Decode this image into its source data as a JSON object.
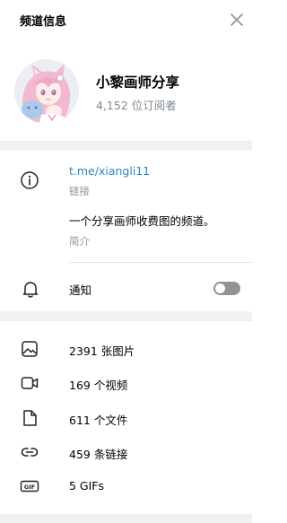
{
  "header": {
    "title": "频道信息"
  },
  "profile": {
    "name": "小黎画师分享",
    "subscribers": "4,152 位订阅者"
  },
  "info": {
    "link": "t.me/xiangli11",
    "link_caption": "链接",
    "description": "一个分享画师收费图的频道。",
    "description_caption": "简介",
    "notifications_label": "通知",
    "notifications_on": false
  },
  "media": {
    "photos": "2391 张图片",
    "videos": "169 个视频",
    "files": "611 个文件",
    "links": "459 条链接",
    "gifs": "5 GIFs",
    "gif_badge": "GIF"
  },
  "colors": {
    "link": "#2e86c1",
    "muted": "#7f8a94",
    "divider": "#f1f1f1",
    "toggle_off": "#8e9397"
  },
  "icons": {
    "close": "close-icon",
    "info": "info-icon",
    "bell": "bell-icon",
    "photo": "photo-icon",
    "video": "video-icon",
    "file": "file-icon",
    "link": "link-icon",
    "gif": "gif-icon"
  }
}
